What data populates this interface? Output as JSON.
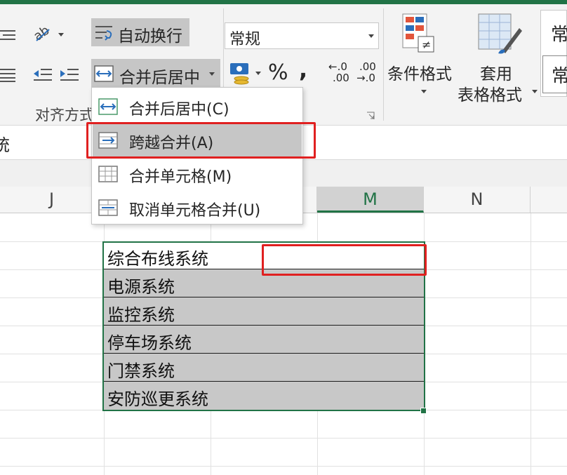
{
  "ribbon": {
    "align_group": {
      "wrap_text_label": "自动换行",
      "merge_center_label": "合并后居中",
      "group_label": "对齐方式"
    },
    "number_group": {
      "format_value": "常规",
      "percent_label": "%",
      "comma_label": ",",
      "inc_decimal_top": "←.0",
      "inc_decimal_bottom": ".00",
      "dec_decimal_top": ".00",
      "dec_decimal_bottom": "→.0"
    },
    "styles_group": {
      "conditional_format_label": "条件格式",
      "table_format_label_1": "套用",
      "table_format_label_2": "表格格式",
      "cell_style_1": "常",
      "cell_style_2": "常"
    }
  },
  "merge_menu": {
    "items": [
      {
        "label": "合并后居中(C)",
        "icon": "merge-center-icon"
      },
      {
        "label": "跨越合并(A)",
        "icon": "merge-across-icon",
        "highlighted": true
      },
      {
        "label": "合并单元格(M)",
        "icon": "merge-cells-icon"
      },
      {
        "label": "取消单元格合并(U)",
        "icon": "unmerge-cells-icon"
      }
    ]
  },
  "formula_bar": {
    "partial_text": "统"
  },
  "columns": {
    "j": "J",
    "m": "M",
    "n": "N"
  },
  "cells": [
    "综合布线系统",
    "电源系统",
    "监控系统",
    "停车场系统",
    "门禁系统",
    "安防巡更系统"
  ],
  "colors": {
    "accent_green": "#217346",
    "annotation_red": "#e02020",
    "selection_gray": "#c8c8c8"
  }
}
